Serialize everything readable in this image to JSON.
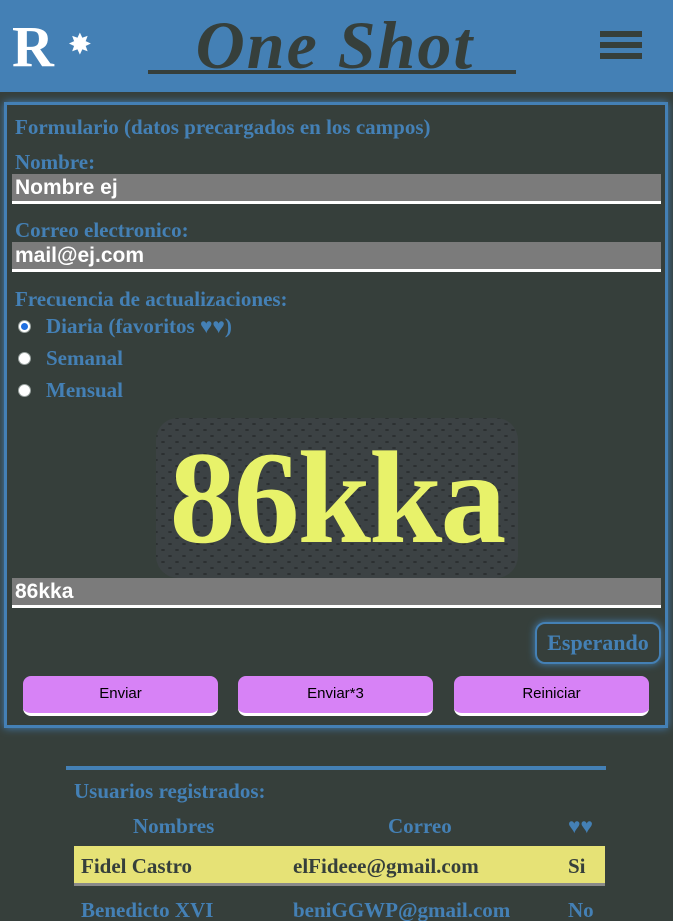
{
  "header": {
    "logo_letter": "R",
    "logo_star": "✸",
    "title": "One Shot",
    "menu_icon": "hamburger-menu-icon"
  },
  "form": {
    "heading": "Formulario (datos precargados en los campos)",
    "name_label": "Nombre:",
    "name_value": "Nombre ej",
    "email_label": "Correo electronico:",
    "email_value": "mail@ej.com",
    "frequency_label": "Frecuencia de actualizaciones:",
    "frequency_options": [
      {
        "label": "Diaria (favoritos ♥♥)",
        "checked": true
      },
      {
        "label": "Semanal",
        "checked": false
      },
      {
        "label": "Mensual",
        "checked": false
      }
    ],
    "captcha_text": "86kka",
    "captcha_value": "86kka",
    "status": "Esperando",
    "buttons": {
      "send": "Enviar",
      "send3": "Enviar*3",
      "reset": "Reiniciar"
    }
  },
  "users": {
    "title": "Usuarios registrados:",
    "headers": {
      "name": "Nombres",
      "email": "Correo",
      "fav": "♥♥"
    },
    "rows": [
      {
        "name": "Fidel Castro",
        "email": "elFideee@gmail.com",
        "fav": "Si"
      },
      {
        "name": "Benedicto XVI",
        "email": "beniGGWP@gmail.com",
        "fav": "No"
      }
    ]
  },
  "colors": {
    "background": "#363f3b",
    "accent": "#4480b5",
    "button": "#d782f6",
    "captcha_text": "#e8f26a",
    "highlight_row": "#e6e276"
  }
}
